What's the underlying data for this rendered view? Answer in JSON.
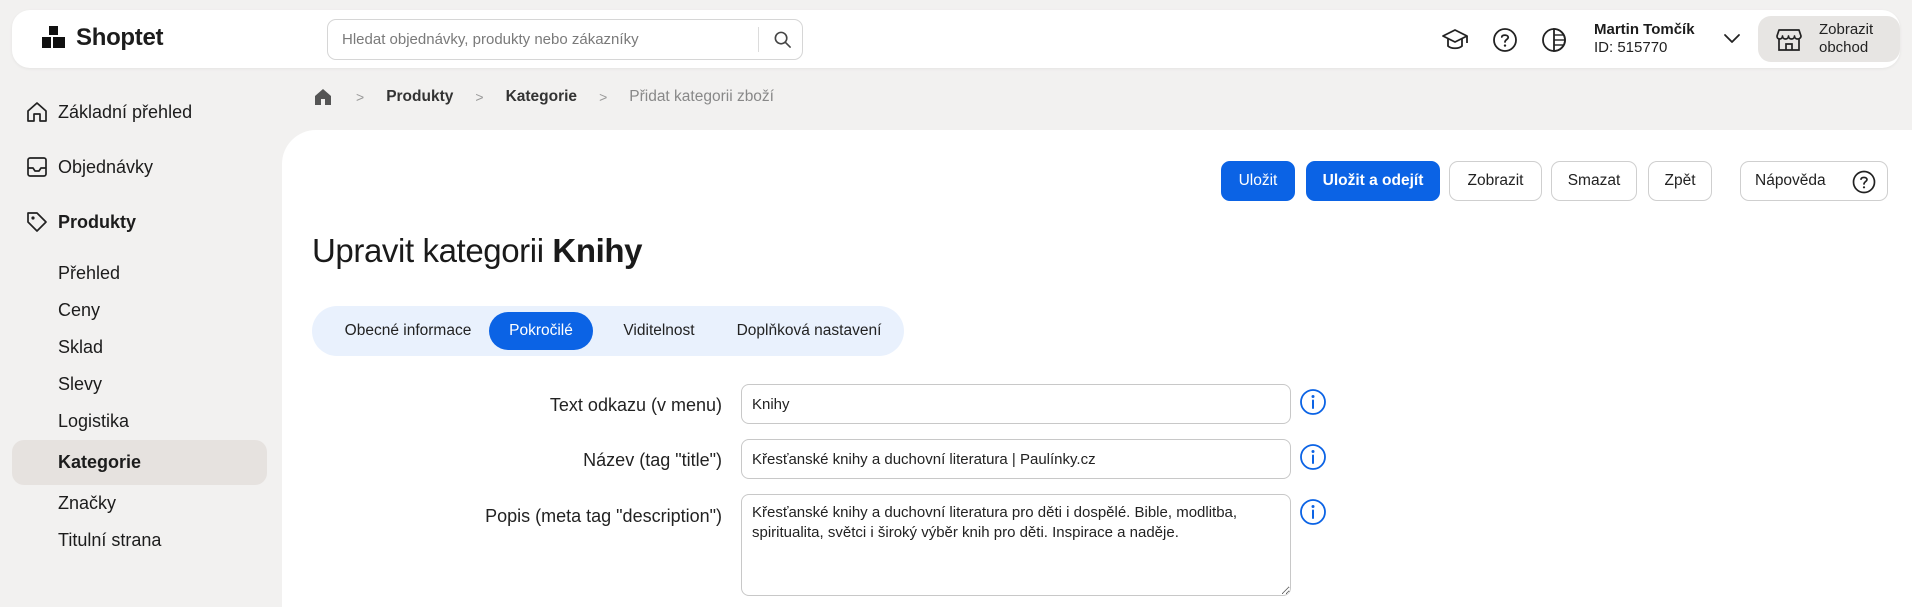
{
  "app": {
    "brand": "Shoptet"
  },
  "search": {
    "placeholder": "Hledat objednávky, produkty nebo zákazníky"
  },
  "user": {
    "name": "Martin Tomčík",
    "id": "ID: 515770"
  },
  "shop_button": {
    "label": "Zobrazit obchod"
  },
  "sidebar": {
    "main": [
      {
        "label": "Základní přehled",
        "icon": "home-icon"
      },
      {
        "label": "Objednávky",
        "icon": "inbox-icon"
      },
      {
        "label": "Produkty",
        "icon": "tag-icon"
      }
    ],
    "sub": [
      {
        "label": "Přehled"
      },
      {
        "label": "Ceny"
      },
      {
        "label": "Sklad"
      },
      {
        "label": "Slevy"
      },
      {
        "label": "Logistika"
      },
      {
        "label": "Kategorie",
        "active": true
      },
      {
        "label": "Značky"
      },
      {
        "label": "Titulní strana"
      }
    ]
  },
  "breadcrumb": {
    "items": [
      "Produkty",
      "Kategorie"
    ],
    "current": "Přidat kategorii zboží"
  },
  "toolbar": {
    "save": "Uložit",
    "save_leave": "Uložit a odejít",
    "view": "Zobrazit",
    "delete": "Smazat",
    "back": "Zpět",
    "help": "Nápověda"
  },
  "page": {
    "title_prefix": "Upravit kategorii",
    "title_name": "Knihy"
  },
  "tabs": [
    {
      "label": "Obecné informace"
    },
    {
      "label": "Pokročilé",
      "active": true
    },
    {
      "label": "Viditelnost"
    },
    {
      "label": "Doplňková nastavení"
    }
  ],
  "form": {
    "link_text": {
      "label": "Text odkazu (v menu)",
      "value": "Knihy"
    },
    "title_tag": {
      "label": "Název (tag \"title\")",
      "value": "Křesťanské knihy a duchovní literatura | Paulínky.cz"
    },
    "description": {
      "label": "Popis (meta tag \"description\")",
      "value": "Křesťanské knihy a duchovní literatura pro děti i dospělé. Bible, modlitba, spiritualita, světci i široký výběr knih pro děti. Inspirace a naděje."
    }
  },
  "colors": {
    "primary": "#0b63e5",
    "tabs_bg": "#e9f1fd",
    "sidebar_active": "#e6e2df",
    "page_bg": "#f2f1f0"
  }
}
